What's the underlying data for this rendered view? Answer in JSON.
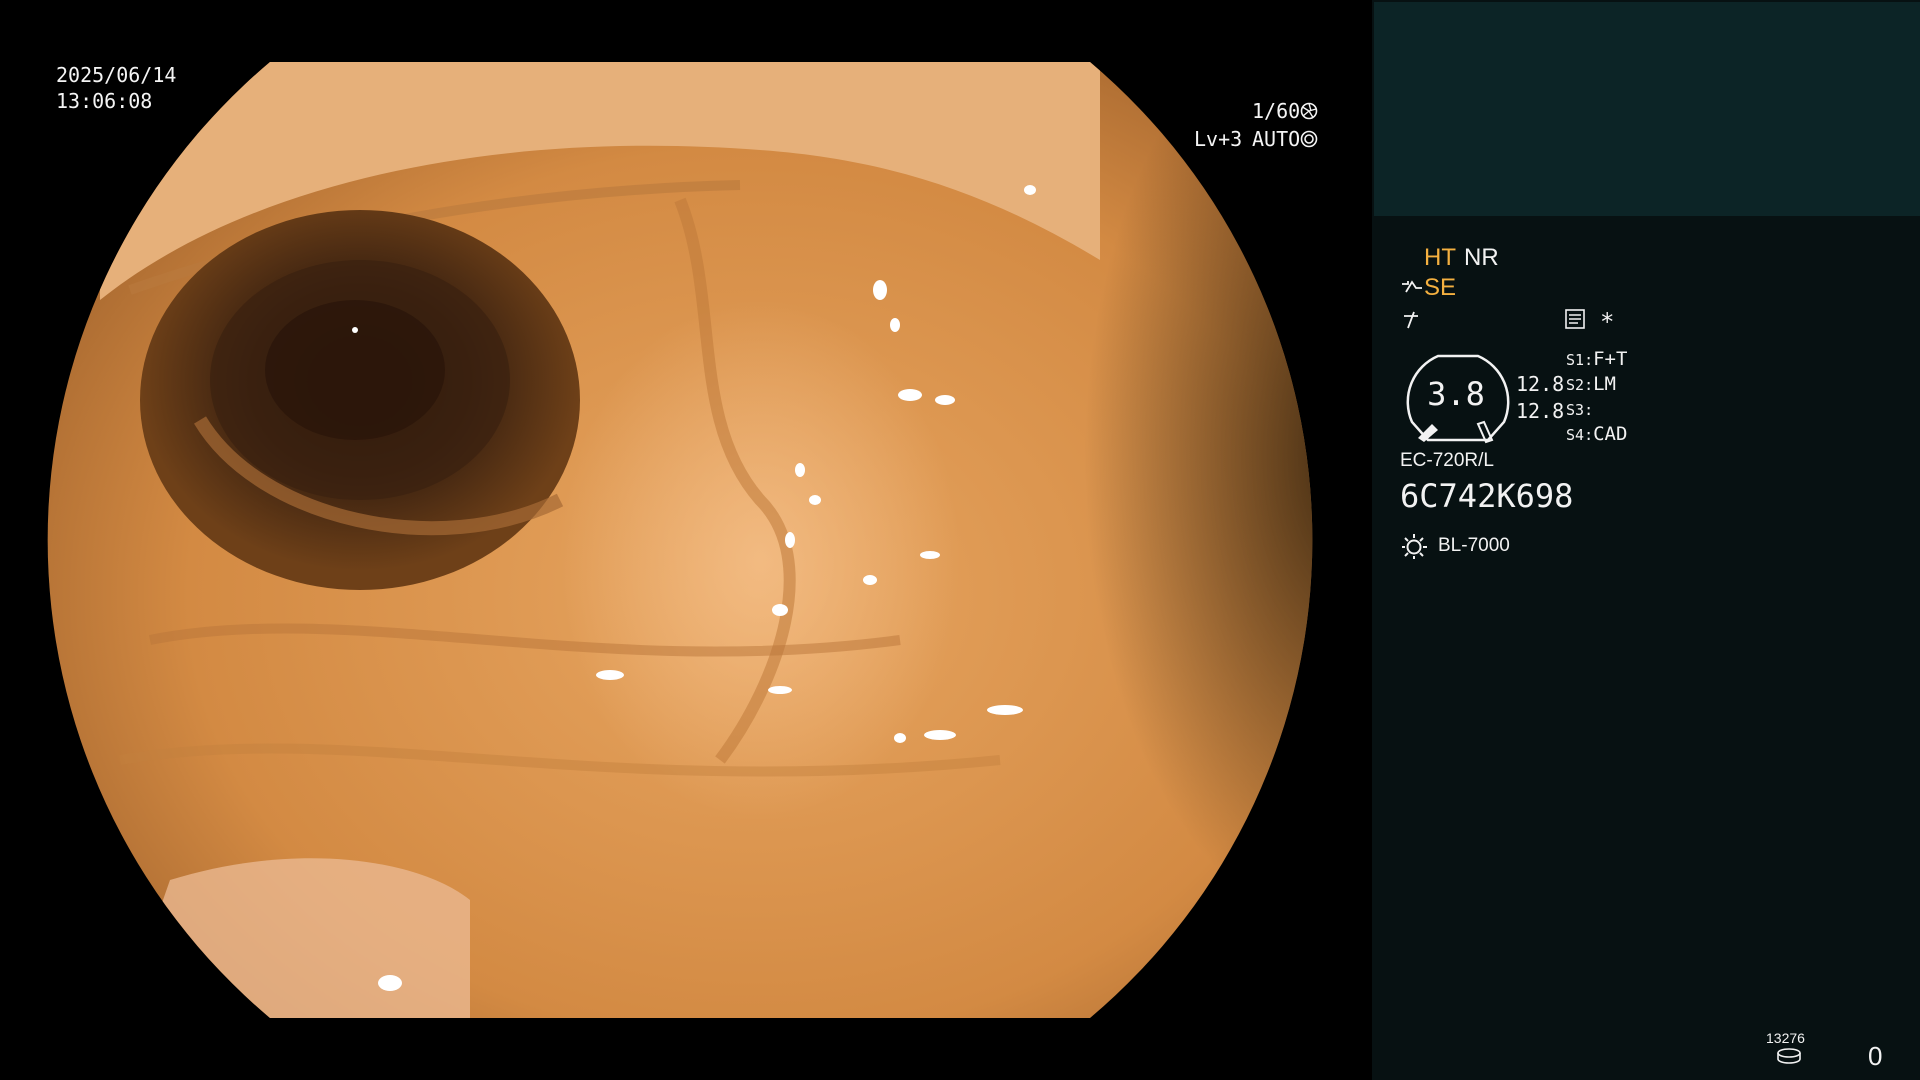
{
  "overlay": {
    "date": "2025/06/14",
    "time": "13:06:08",
    "shutter": "1/60",
    "exposure_level": "Lv+3",
    "exposure_mode": "AUTO",
    "shutter_icon": "shutter-icon",
    "iris_icon": "iris-icon"
  },
  "panel": {
    "mode_ht": "HT",
    "mode_nr": "NR",
    "mode_se": "SE",
    "se_icon": "structure-enhance-icon",
    "freeze_icon": "freeze-icon",
    "record_icon": "record-settings-icon",
    "star": "*",
    "dial_value": "3.8",
    "left_value_1": "12.8",
    "left_value_2": "12.8",
    "switches": [
      {
        "key": "S1",
        "value": "F+T"
      },
      {
        "key": "S2",
        "value": "LM"
      },
      {
        "key": "S3",
        "value": ""
      },
      {
        "key": "S4",
        "value": "CAD"
      }
    ],
    "scope_model": "EC-720R/L",
    "serial": "6C742K698",
    "light_icon": "light-source-icon",
    "light_source": "BL-7000",
    "storage_count": "13276",
    "storage_icon": "storage-disk-icon",
    "counter": "0"
  },
  "colors": {
    "panel_bg": "#071112",
    "thumb_bg": "#0c2426",
    "accent_orange": "#f4b040"
  }
}
